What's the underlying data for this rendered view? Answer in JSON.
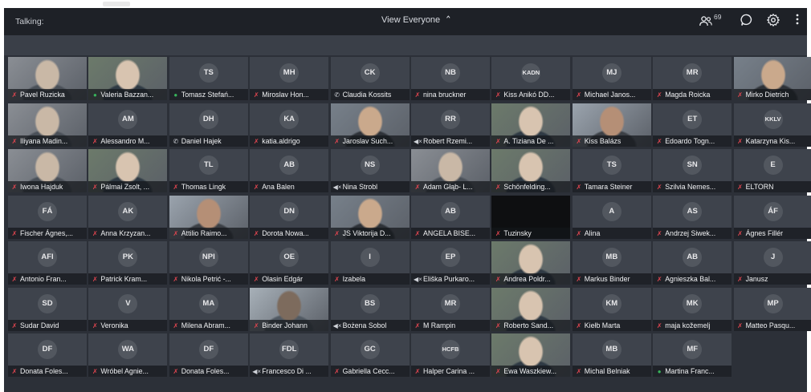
{
  "header": {
    "talking_label": "Talking:",
    "view_everyone_label": "View Everyone",
    "participant_count": "69"
  },
  "icons": {
    "muted": "muted-mic-icon",
    "speaking": "mic-icon",
    "phone": "phone-icon",
    "speaker": "speaker-icon"
  },
  "colors": {
    "muted": "#e0454f",
    "speaking": "#37b35a",
    "background": "#2c3038"
  },
  "tiles": [
    {
      "name": "Pavel Ruzicka",
      "initials": "",
      "status": "muted",
      "video": true
    },
    {
      "name": "Valeria Bazzan...",
      "initials": "",
      "status": "speaking",
      "video": true
    },
    {
      "name": "Tomasz Stefań...",
      "initials": "TS",
      "status": "speaking",
      "video": false
    },
    {
      "name": "Miroslav Hon...",
      "initials": "MH",
      "status": "muted",
      "video": false
    },
    {
      "name": "Claudia Kossits",
      "initials": "CK",
      "status": "phone",
      "video": false
    },
    {
      "name": "nina bruckner",
      "initials": "NB",
      "status": "muted",
      "video": false
    },
    {
      "name": "Kiss Anikó DD...",
      "initials": "KADN",
      "status": "muted",
      "video": false
    },
    {
      "name": "Michael Janos...",
      "initials": "MJ",
      "status": "muted",
      "video": false
    },
    {
      "name": "Magda Roicka",
      "initials": "MR",
      "status": "muted",
      "video": false
    },
    {
      "name": "Mirko Dietrich",
      "initials": "",
      "status": "muted",
      "video": true
    },
    {
      "name": "Iliyana Madin...",
      "initials": "",
      "status": "muted",
      "video": true
    },
    {
      "name": "Alessandro M...",
      "initials": "AM",
      "status": "muted",
      "video": false
    },
    {
      "name": "Daniel Hajek",
      "initials": "DH",
      "status": "phone",
      "video": false
    },
    {
      "name": "katia.aldrigo",
      "initials": "KA",
      "status": "muted",
      "video": false
    },
    {
      "name": "Jaroslav Such...",
      "initials": "",
      "status": "muted",
      "video": true
    },
    {
      "name": "Robert Rzemi...",
      "initials": "RR",
      "status": "speaker",
      "video": false
    },
    {
      "name": "A. Tiziana De ...",
      "initials": "",
      "status": "muted",
      "video": true
    },
    {
      "name": "Kiss Balázs",
      "initials": "",
      "status": "muted",
      "video": true
    },
    {
      "name": "Edoardo Togn...",
      "initials": "ET",
      "status": "muted",
      "video": false
    },
    {
      "name": "Katarzyna Kis...",
      "initials": "KKLV",
      "status": "muted",
      "video": false
    },
    {
      "name": "Iwona Hajduk",
      "initials": "",
      "status": "muted",
      "video": true
    },
    {
      "name": "Pálmai Zsolt, ...",
      "initials": "",
      "status": "muted",
      "video": true
    },
    {
      "name": "Thomas Lingk",
      "initials": "TL",
      "status": "muted",
      "video": false
    },
    {
      "name": "Ana Balen",
      "initials": "AB",
      "status": "muted",
      "video": false
    },
    {
      "name": "Nina Strobl",
      "initials": "NS",
      "status": "speaker",
      "video": false
    },
    {
      "name": "Adam Głąb- L...",
      "initials": "",
      "status": "muted",
      "video": true
    },
    {
      "name": "Schönfelding...",
      "initials": "",
      "status": "muted",
      "video": true
    },
    {
      "name": "Tamara Steiner",
      "initials": "TS",
      "status": "muted",
      "video": false
    },
    {
      "name": "Szilvia Nemes...",
      "initials": "SN",
      "status": "muted",
      "video": false
    },
    {
      "name": "ELTORN",
      "initials": "E",
      "status": "muted",
      "video": false
    },
    {
      "name": "Fischer Ágnes,...",
      "initials": "FÁ",
      "status": "muted",
      "video": false
    },
    {
      "name": "Anna Krzyzan...",
      "initials": "AK",
      "status": "muted",
      "video": false
    },
    {
      "name": "Attilio Raimo...",
      "initials": "",
      "status": "muted",
      "video": true
    },
    {
      "name": "Dorota Nowa...",
      "initials": "DN",
      "status": "muted",
      "video": false
    },
    {
      "name": "JS Viktorija D...",
      "initials": "",
      "status": "muted",
      "video": true
    },
    {
      "name": "ANGELA BISE...",
      "initials": "AB",
      "status": "muted",
      "video": false
    },
    {
      "name": "Tuzinsky",
      "initials": "",
      "status": "muted",
      "video": false,
      "black": true
    },
    {
      "name": "Alina",
      "initials": "A",
      "status": "muted",
      "video": false
    },
    {
      "name": "Andrzej Siwek...",
      "initials": "AS",
      "status": "muted",
      "video": false
    },
    {
      "name": "Ágnes Fillér",
      "initials": "ÁF",
      "status": "muted",
      "video": false
    },
    {
      "name": "Antonio Fran...",
      "initials": "AFI",
      "status": "muted",
      "video": false
    },
    {
      "name": "Patrick Kram...",
      "initials": "PK",
      "status": "muted",
      "video": false
    },
    {
      "name": "Nikola Petrić -...",
      "initials": "NPI",
      "status": "muted",
      "video": false
    },
    {
      "name": "Olasin Edgár",
      "initials": "OE",
      "status": "muted",
      "video": false
    },
    {
      "name": "Izabela",
      "initials": "I",
      "status": "muted",
      "video": false
    },
    {
      "name": "Eliška Purkaro...",
      "initials": "EP",
      "status": "speaker",
      "video": false
    },
    {
      "name": "Andrea Poldr...",
      "initials": "",
      "status": "muted",
      "video": true
    },
    {
      "name": "Markus Binder",
      "initials": "MB",
      "status": "muted",
      "video": false
    },
    {
      "name": "Agnieszka Bal...",
      "initials": "AB",
      "status": "muted",
      "video": false
    },
    {
      "name": "Janusz",
      "initials": "J",
      "status": "muted",
      "video": false
    },
    {
      "name": "Sudar David",
      "initials": "SD",
      "status": "muted",
      "video": false
    },
    {
      "name": "Veronika",
      "initials": "V",
      "status": "muted",
      "video": false
    },
    {
      "name": "Milena Abram...",
      "initials": "MA",
      "status": "muted",
      "video": false
    },
    {
      "name": "Binder Johann",
      "initials": "",
      "status": "muted",
      "video": true
    },
    {
      "name": "Bożena Sobol",
      "initials": "BS",
      "status": "speaker",
      "video": false
    },
    {
      "name": "M Rampin",
      "initials": "MR",
      "status": "muted",
      "video": false
    },
    {
      "name": "Roberto Sand...",
      "initials": "",
      "status": "muted",
      "video": true
    },
    {
      "name": "Kiełb Marta",
      "initials": "KM",
      "status": "muted",
      "video": false
    },
    {
      "name": "maja kožemelj",
      "initials": "MK",
      "status": "muted",
      "video": false
    },
    {
      "name": "Matteo Pasqu...",
      "initials": "MP",
      "status": "muted",
      "video": false
    },
    {
      "name": "Donata Foles...",
      "initials": "DF",
      "status": "muted",
      "video": false
    },
    {
      "name": "Wróbel Agnie...",
      "initials": "WA",
      "status": "muted",
      "video": false
    },
    {
      "name": "Donata Foles...",
      "initials": "DF",
      "status": "muted",
      "video": false
    },
    {
      "name": "Francesco Di ...",
      "initials": "FDL",
      "status": "speaker",
      "video": false
    },
    {
      "name": "Gabriella Cecc...",
      "initials": "GC",
      "status": "muted",
      "video": false
    },
    {
      "name": "Halper Carina ...",
      "initials": "HCFB",
      "status": "muted",
      "video": false
    },
    {
      "name": "Ewa Waszkiew...",
      "initials": "",
      "status": "muted",
      "video": true
    },
    {
      "name": "Michal Belniak",
      "initials": "MB",
      "status": "muted",
      "video": false
    },
    {
      "name": "Martina Franc...",
      "initials": "MF",
      "status": "speaking",
      "video": false
    }
  ]
}
